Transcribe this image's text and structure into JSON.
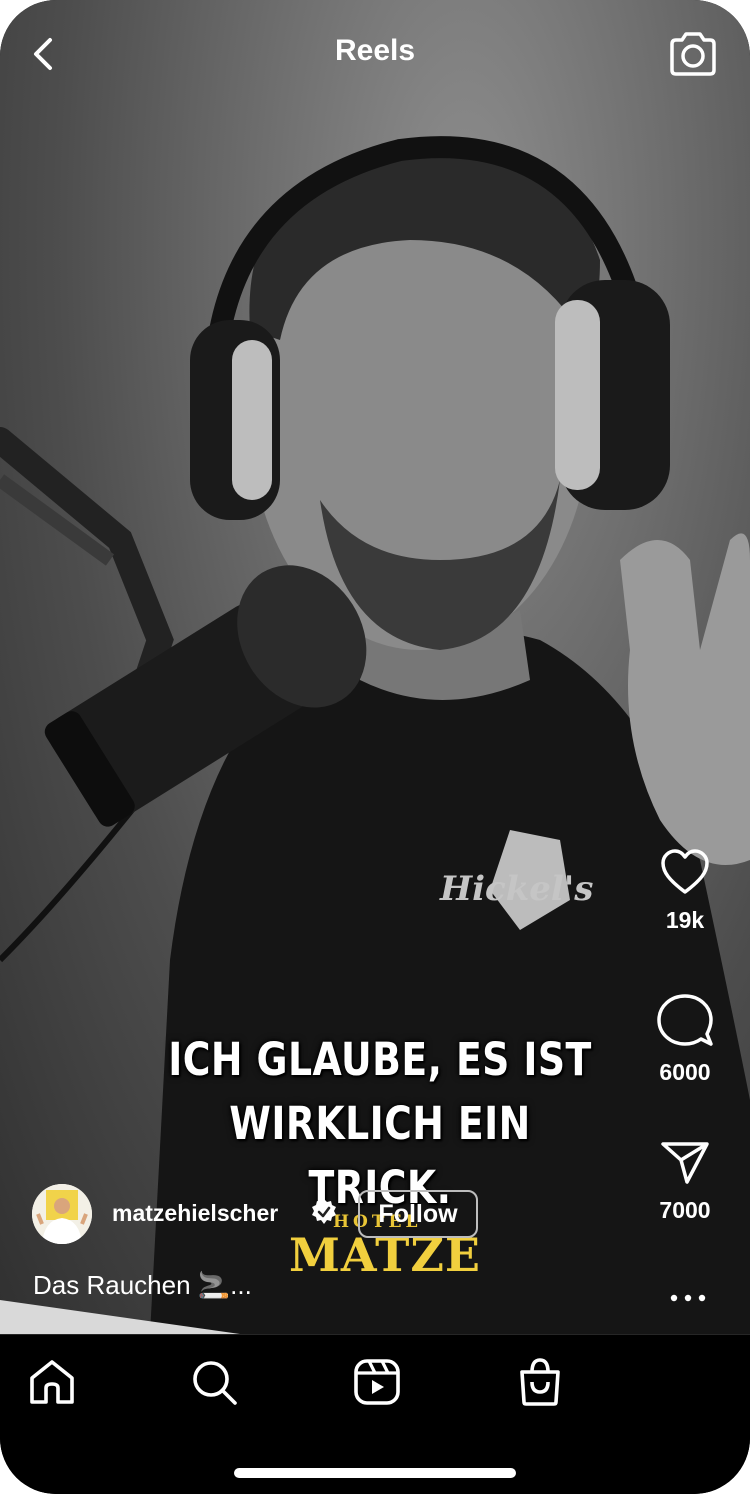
{
  "header": {
    "title": "Reels"
  },
  "video": {
    "subtitle_line1": "ICH GLAUBE, ES IST",
    "subtitle_line2": "WIRKLICH EIN TRICK.",
    "shirt_logo": "Hickel's",
    "overlay_logo_small": "HOTEL",
    "overlay_logo_large": "MATZE"
  },
  "actions": {
    "likes": "19k",
    "comments": "6000",
    "shares": "7000"
  },
  "author": {
    "username": "matzehielscher",
    "follow_label": "Follow",
    "verified": true
  },
  "caption": "Das Rauchen 🚬...",
  "nav": {
    "items": [
      "home-icon",
      "search-icon",
      "reels-icon",
      "shop-icon"
    ]
  },
  "colors": {
    "text": "#ffffff",
    "logo_gold": "#f1cf3e",
    "nav_background": "#000000"
  }
}
